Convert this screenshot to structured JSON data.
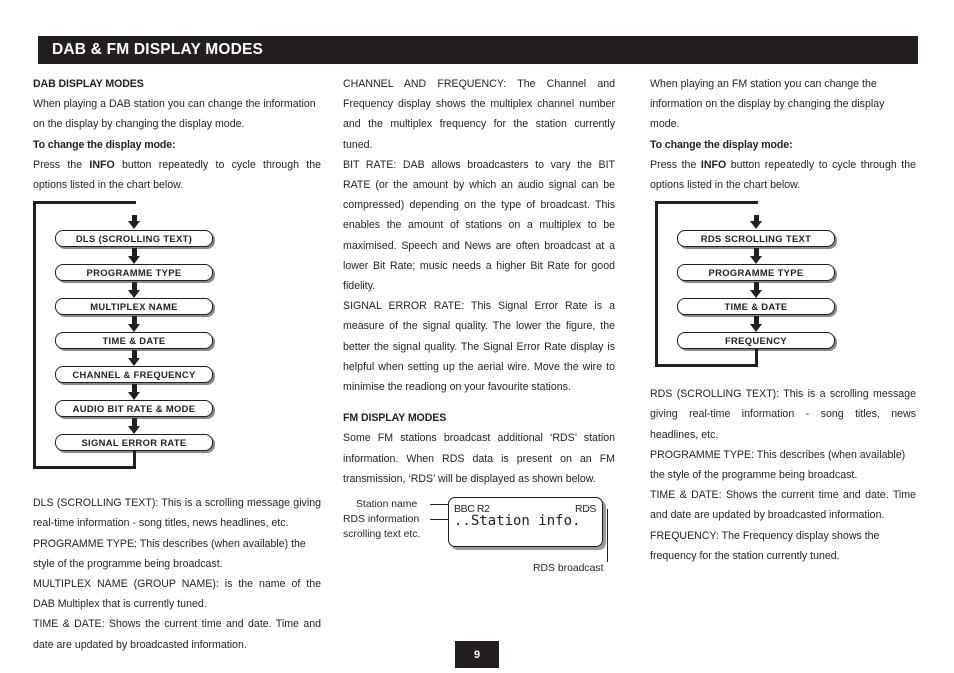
{
  "header": {
    "title": "DAB & FM DISPLAY MODES",
    "bar_color": "#231f20",
    "text_color": "#ffffff"
  },
  "column1": {
    "section_heading": "DAB DISPLAY MODES",
    "intro": "When playing a DAB station you can change the information on the display by changing the display mode.",
    "instruction_heading": "To change the display mode:",
    "instruction_pre": "Press the ",
    "instruction_bold": "INFO",
    "instruction_post": " button repeatedly to cycle through the options listed in the chart below.",
    "flowchart": {
      "name": "dab-display-modes-flowchart",
      "boxes": [
        "DLS (SCROLLING TEXT)",
        "PROGRAMME TYPE",
        "MULTIPLEX NAME",
        "TIME & DATE",
        "CHANNEL & FREQUENCY",
        "AUDIO BIT RATE & MODE",
        "SIGNAL ERROR RATE"
      ]
    },
    "definitions": [
      "DLS (SCROLLING TEXT): This is a scrolling message giving real-time information - song titles, news headlines, etc.",
      "PROGRAMME TYPE: This describes (when available) the style of the programme being broadcast.",
      "MULTIPLEX NAME (GROUP NAME): is the name of the DAB Multiplex that is currently tuned.",
      "TIME & DATE: Shows the current time and date. Time and date are updated by  broadcasted information."
    ]
  },
  "column2": {
    "paragraphs": [
      "CHANNEL AND FREQUENCY: The Channel and Frequency display shows the multiplex channel number and the multiplex frequency for the station currently tuned.",
      "BIT RATE: DAB allows broadcasters to vary the BIT RATE (or the amount by which an audio signal can be compressed) depending on the type of broadcast. This enables the amount of stations on a multiplex to be maximised. Speech and News are often broadcast at a lower Bit Rate; music needs a higher Bit Rate for good fidelity.",
      "SIGNAL ERROR RATE: This Signal Error Rate is a measure of the signal quality. The lower the figure, the better the signal quality. The Signal Error Rate display is helpful when setting up the aerial wire. Move the wire to minimise the readiong on your favourite stations."
    ],
    "fm_section_heading": "FM DISPLAY MODES",
    "fm_intro": "Some FM stations broadcast additional ‘RDS’ station information. When RDS data is present on an FM transmission, ‘RDS’ will be displayed as shown below.",
    "rds_figure": {
      "name": "rds-display-illustration",
      "callout_station_name": "Station name",
      "callout_rds_info_line1": "RDS information",
      "callout_rds_info_line2": "scrolling text etc.",
      "callout_rds_broadcast": "RDS broadcast",
      "lcd_station": "BBC R2",
      "lcd_indicator": "RDS",
      "lcd_scrolling_text": "..Station info."
    }
  },
  "column3": {
    "intro": "When playing an FM station you can change the information on the display by changing the display mode.",
    "instruction_heading": "To change the display mode:",
    "instruction_pre": "Press the ",
    "instruction_bold": "INFO",
    "instruction_post": " button repeatedly to cycle through the options listed in the chart below.",
    "flowchart": {
      "name": "fm-display-modes-flowchart",
      "boxes": [
        "RDS SCROLLING TEXT",
        "PROGRAMME TYPE",
        "TIME & DATE",
        "FREQUENCY"
      ]
    },
    "definitions": [
      "RDS (SCROLLING TEXT): This is a scrolling message giving real-time information - song titles, news headlines, etc.",
      "PROGRAMME TYPE: This describes (when available) the style of the programme being broadcast.",
      "TIME & DATE: Shows the current time and date. Time and date are updated by  broadcasted information.",
      "FREQUENCY: The Frequency display shows the frequency for the station currently tuned."
    ]
  },
  "footer": {
    "page_number": "9"
  }
}
